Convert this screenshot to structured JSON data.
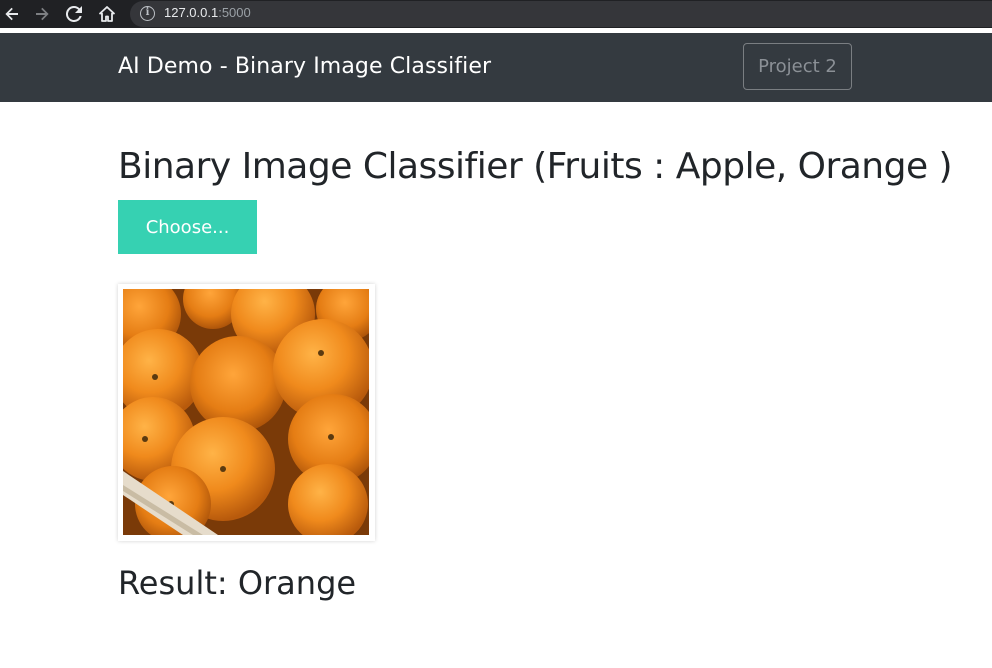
{
  "browser": {
    "url_host": "127.0.0.1",
    "url_port": ":5000"
  },
  "navbar": {
    "brand": "AI Demo - Binary Image Classifier",
    "project_button": "Project 2"
  },
  "main": {
    "title": "Binary Image Classifier (Fruits : Apple, Orange )",
    "choose_button": "Choose...",
    "result_text": "Result: Orange"
  },
  "colors": {
    "navbar_bg": "#343a40",
    "choose_button_bg": "#36d1b2",
    "chrome_bg": "#202124"
  }
}
